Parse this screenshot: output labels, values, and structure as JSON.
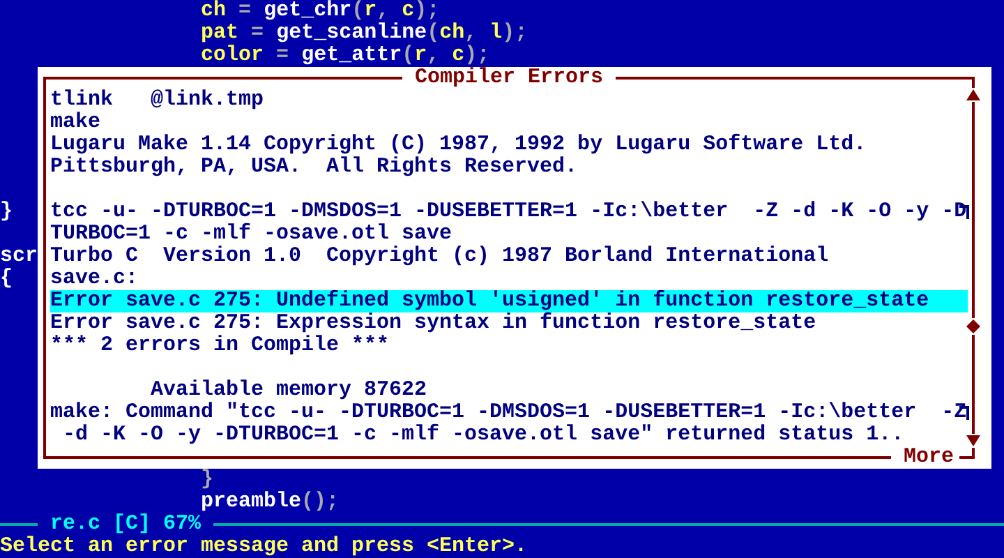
{
  "editor": {
    "lines_above": [
      {
        "text": "ch = get_chr(r, c);"
      },
      {
        "text": "pat = get_scanline(ch, l);"
      },
      {
        "text": "color = get_attr(r, c);"
      }
    ],
    "lines_below": [
      {
        "text": "}"
      },
      {
        "text": "preamble();"
      }
    ]
  },
  "dialog": {
    "title": "Compiler Errors",
    "more_label": "More",
    "lines": [
      {
        "text": "tlink   @link.tmp",
        "selected": false,
        "wrapped": false
      },
      {
        "text": "make",
        "selected": false,
        "wrapped": false
      },
      {
        "text": "Lugaru Make 1.14 Copyright (C) 1987, 1992 by Lugaru Software Ltd.",
        "selected": false,
        "wrapped": false
      },
      {
        "text": "Pittsburgh, PA, USA.  All Rights Reserved.",
        "selected": false,
        "wrapped": false
      },
      {
        "selected": false,
        "wrapped": false
      },
      {
        "text": "tcc -u- -DTURBOC=1 -DMSDOS=1 -DUSEBETTER=1 -Ic:\\better  -Z -d -K -O -y -D",
        "selected": false,
        "wrapped": true,
        "gutter": "}"
      },
      {
        "text": "TURBOC=1 -c -mlf -osave.otl save",
        "selected": false,
        "wrapped": false
      },
      {
        "text": "Turbo C  Version 1.0  Copyright (c) 1987 Borland International",
        "selected": false,
        "wrapped": false,
        "gutter": "scr"
      },
      {
        "text": "save.c:",
        "selected": false,
        "wrapped": false,
        "gutter": "{"
      },
      {
        "text": "Error save.c 275: Undefined symbol 'usigned' in function restore_state",
        "selected": true,
        "wrapped": false
      },
      {
        "text": "Error save.c 275: Expression syntax in function restore_state",
        "selected": false,
        "wrapped": false
      },
      {
        "text": "*** 2 errors in Compile ***",
        "selected": false,
        "wrapped": false
      },
      {
        "selected": false,
        "wrapped": false
      },
      {
        "text": "        Available memory 87622",
        "selected": false,
        "wrapped": false
      },
      {
        "text": "make: Command \"tcc -u- -DTURBOC=1 -DMSDOS=1 -DUSEBETTER=1 -Ic:\\better  -Z",
        "selected": false,
        "wrapped": true
      },
      {
        "text": " -d -K -O -y -DTURBOC=1 -c -mlf -osave.otl save\" returned status 1..",
        "selected": false,
        "wrapped": false
      }
    ]
  },
  "status_bar": {
    "file_label": "re.c [C] 67%"
  },
  "prompt": "Select an error message and press <Enter>."
}
